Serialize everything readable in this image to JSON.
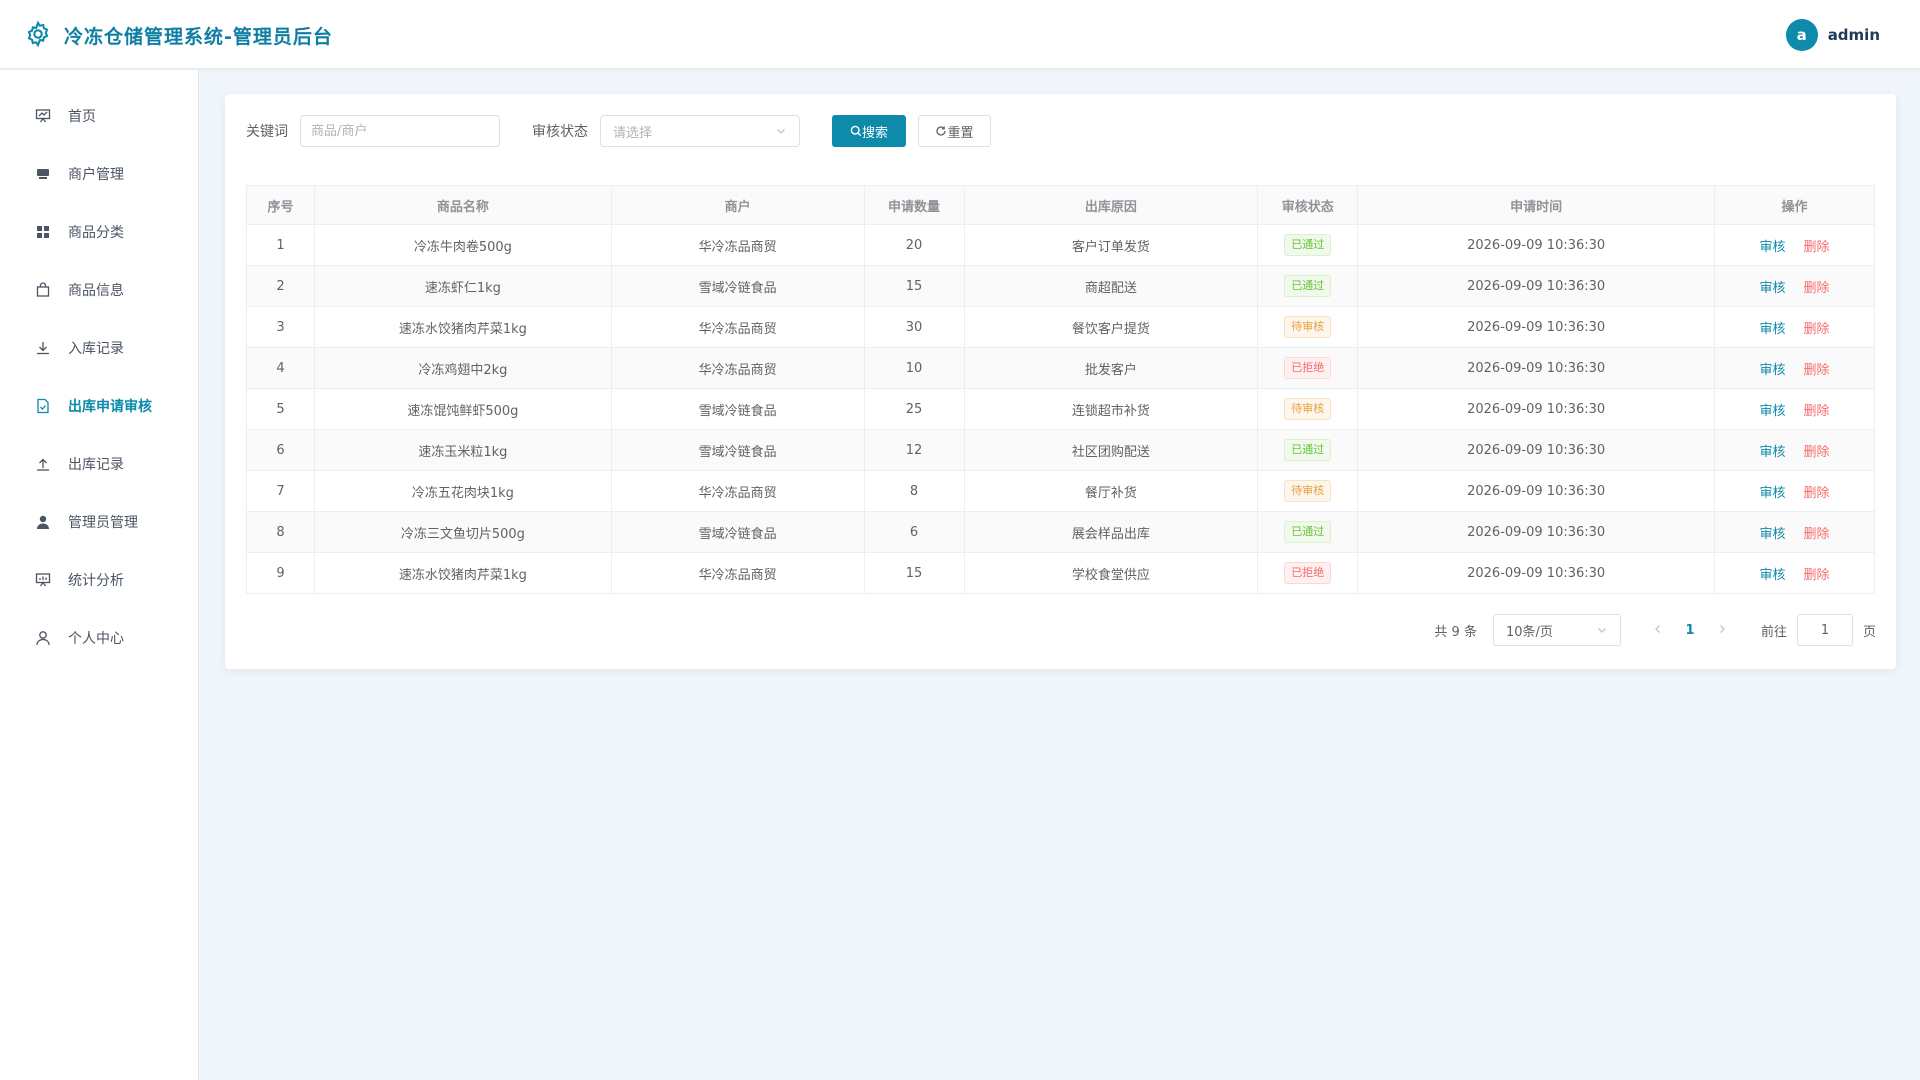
{
  "header": {
    "title": "冷冻仓储管理系统-管理员后台",
    "avatar_letter": "a",
    "username": "admin"
  },
  "sidebar": {
    "items": [
      {
        "label": "首页",
        "icon": "presentation-icon",
        "active": false
      },
      {
        "label": "商户管理",
        "icon": "merchant-icon",
        "active": false
      },
      {
        "label": "商品分类",
        "icon": "grid-icon",
        "active": false
      },
      {
        "label": "商品信息",
        "icon": "bag-icon",
        "active": false
      },
      {
        "label": "入库记录",
        "icon": "download-icon",
        "active": false
      },
      {
        "label": "出库申请审核",
        "icon": "document-check-icon",
        "active": true
      },
      {
        "label": "出库记录",
        "icon": "upload-icon",
        "active": false
      },
      {
        "label": "管理员管理",
        "icon": "user-filled-icon",
        "active": false
      },
      {
        "label": "统计分析",
        "icon": "chart-icon",
        "active": false
      },
      {
        "label": "个人中心",
        "icon": "user-icon",
        "active": false
      }
    ]
  },
  "search": {
    "keyword_label": "关键词",
    "keyword_placeholder": "商品/商户",
    "status_label": "审核状态",
    "status_placeholder": "请选择",
    "search_button": "搜索",
    "reset_button": "重置"
  },
  "table": {
    "columns": [
      "序号",
      "商品名称",
      "商户",
      "申请数量",
      "出库原因",
      "审核状态",
      "申请时间",
      "操作"
    ],
    "action_review": "审核",
    "action_delete": "删除",
    "rows": [
      {
        "no": "1",
        "product": "冷冻牛肉卷500g",
        "merchant": "华冷冻品商贸",
        "qty": "20",
        "reason": "客户订单发货",
        "status": "已通过",
        "status_type": "pass",
        "time": "2026-09-09 10:36:30"
      },
      {
        "no": "2",
        "product": "速冻虾仁1kg",
        "merchant": "雪域冷链食品",
        "qty": "15",
        "reason": "商超配送",
        "status": "已通过",
        "status_type": "pass",
        "time": "2026-09-09 10:36:30"
      },
      {
        "no": "3",
        "product": "速冻水饺猪肉芹菜1kg",
        "merchant": "华冷冻品商贸",
        "qty": "30",
        "reason": "餐饮客户提货",
        "status": "待审核",
        "status_type": "wait",
        "time": "2026-09-09 10:36:30"
      },
      {
        "no": "4",
        "product": "冷冻鸡翅中2kg",
        "merchant": "华冷冻品商贸",
        "qty": "10",
        "reason": "批发客户",
        "status": "已拒绝",
        "status_type": "reject",
        "time": "2026-09-09 10:36:30"
      },
      {
        "no": "5",
        "product": "速冻馄饨鲜虾500g",
        "merchant": "雪域冷链食品",
        "qty": "25",
        "reason": "连锁超市补货",
        "status": "待审核",
        "status_type": "wait",
        "time": "2026-09-09 10:36:30"
      },
      {
        "no": "6",
        "product": "速冻玉米粒1kg",
        "merchant": "雪域冷链食品",
        "qty": "12",
        "reason": "社区团购配送",
        "status": "已通过",
        "status_type": "pass",
        "time": "2026-09-09 10:36:30"
      },
      {
        "no": "7",
        "product": "冷冻五花肉块1kg",
        "merchant": "华冷冻品商贸",
        "qty": "8",
        "reason": "餐厅补货",
        "status": "待审核",
        "status_type": "wait",
        "time": "2026-09-09 10:36:30"
      },
      {
        "no": "8",
        "product": "冷冻三文鱼切片500g",
        "merchant": "雪域冷链食品",
        "qty": "6",
        "reason": "展会样品出库",
        "status": "已通过",
        "status_type": "pass",
        "time": "2026-09-09 10:36:30"
      },
      {
        "no": "9",
        "product": "速冻水饺猪肉芹菜1kg",
        "merchant": "华冷冻品商贸",
        "qty": "15",
        "reason": "学校食堂供应",
        "status": "已拒绝",
        "status_type": "reject",
        "time": "2026-09-09 10:36:30"
      }
    ]
  },
  "pagination": {
    "total_text": "共 9 条",
    "page_size": "10条/页",
    "current_page": "1",
    "goto_label": "前往",
    "goto_value": "1",
    "page_suffix": "页"
  },
  "colors": {
    "primary": "#0e8aaa",
    "title": "#0e7ea3",
    "pass": "#67c23a",
    "wait": "#e6a23c",
    "reject": "#f56c6c",
    "background": "#f0f6fc"
  }
}
